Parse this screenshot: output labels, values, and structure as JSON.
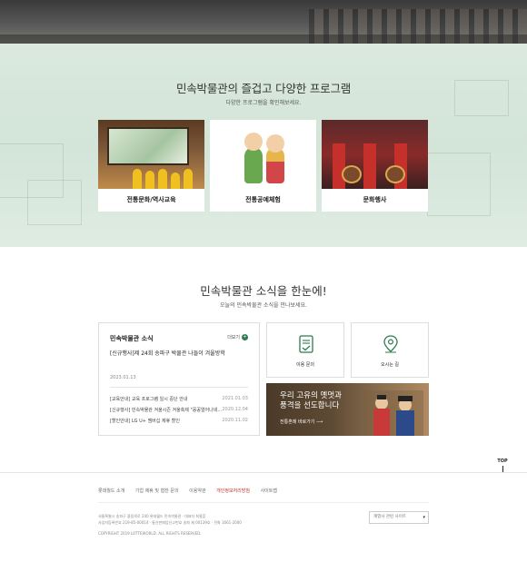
{
  "programs": {
    "title": "민속박물관의 즐겁고 다양한 프로그램",
    "subtitle": "다양한 프로그램을 확인해보세요.",
    "cards": [
      {
        "label": "전통문화/역사교육"
      },
      {
        "label": "전통공예체험"
      },
      {
        "label": "문화행사"
      }
    ]
  },
  "news": {
    "title": "민속박물관 소식을 한눈에!",
    "subtitle": "오늘의 민속박물관 소식을 만나보세요.",
    "box_title": "민속박물관 소식",
    "more_label": "더보기",
    "lead": "[신규행사]제 24회 송파구 박물관 나들이 겨울방학",
    "lead_date": "2023.01.13",
    "items": [
      {
        "text": "[교육안내] 교육 프로그램 일시 중단 안내",
        "date": "2021.01.03"
      },
      {
        "text": "[신규행사] 민속박물관 겨울시즌 겨울축제 \"꽁꽁얼어나네...",
        "date": "2020.12.04"
      },
      {
        "text": "[할인안내] LG U+ 멤버십 제휴 할인",
        "date": "2020.11.02"
      }
    ]
  },
  "tiles": [
    {
      "label": "이용 문의",
      "icon": "document-check-icon"
    },
    {
      "label": "오시는 길",
      "icon": "location-pin-icon"
    }
  ],
  "promo": {
    "line1": "우리 고유의 옛멋과",
    "line2": "풍격을 선도합니다",
    "link": "전통혼례 바로가기 ⟶"
  },
  "top_label": "TOP",
  "footer": {
    "nav": [
      "롯데월드 소개",
      "기업 제휴 및 협찬 문의",
      "이용약관",
      "개인정보처리방침",
      "사이트맵"
    ],
    "highlight_index": 3,
    "address": "서울특별시 송파구 올림픽로 240 롯데월드 민속박물관 · 대표자 최홍훈",
    "business": "사업자등록번호 219-85-00014 · 통신판매업신고번호 송파 제 00139호 · 전화 1661-2000",
    "copyright": "COPYRIGHT 2019 LOTTEWORLD. ALL RIGHTS RESERVED.",
    "family_site": "계열사 관련 사이트"
  },
  "colors": {
    "accent_green": "#2f7b52",
    "highlight_red": "#b8302a",
    "section_bg": "#d3e4d8"
  }
}
